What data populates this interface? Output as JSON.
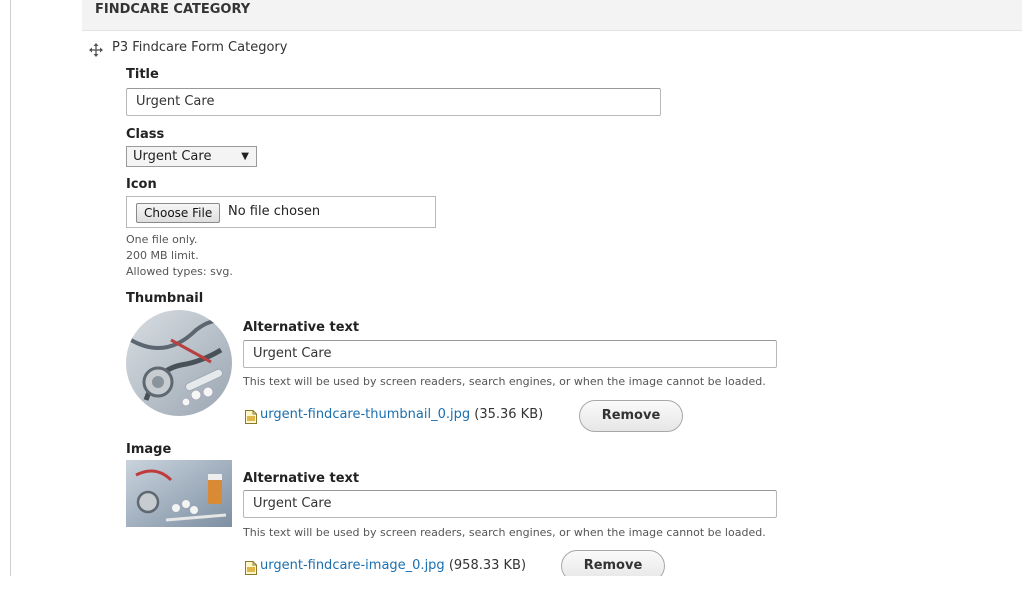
{
  "section": {
    "title": "FINDCARE CATEGORY"
  },
  "item": {
    "title": "P3 Findcare Form Category"
  },
  "fields": {
    "title": {
      "label": "Title",
      "value": "Urgent Care"
    },
    "class": {
      "label": "Class",
      "selected": "Urgent Care",
      "arrow": "▼"
    },
    "icon": {
      "label": "Icon",
      "button": "Choose File",
      "status": "No file chosen",
      "help": [
        "One file only.",
        "200 MB limit.",
        "Allowed types: svg."
      ]
    },
    "thumbnail": {
      "label": "Thumbnail",
      "alt_label": "Alternative text",
      "alt_value": "Urgent Care",
      "alt_help": "This text will be used by screen readers, search engines, or when the image cannot be loaded.",
      "file_name": "urgent-findcare-thumbnail_0.jpg",
      "file_size": "(35.36 KB)",
      "remove": "Remove"
    },
    "image": {
      "label": "Image",
      "alt_label": "Alternative text",
      "alt_value": "Urgent Care",
      "alt_help": "This text will be used by screen readers, search engines, or when the image cannot be loaded.",
      "file_name": "urgent-findcare-image_0.jpg",
      "file_size": "(958.33 KB)",
      "remove": "Remove"
    }
  },
  "colors": {
    "link": "#1a6fb0",
    "section_bg": "#f3f3f3"
  },
  "icons": [
    "move-handle-icon",
    "jpg-file-icon"
  ]
}
